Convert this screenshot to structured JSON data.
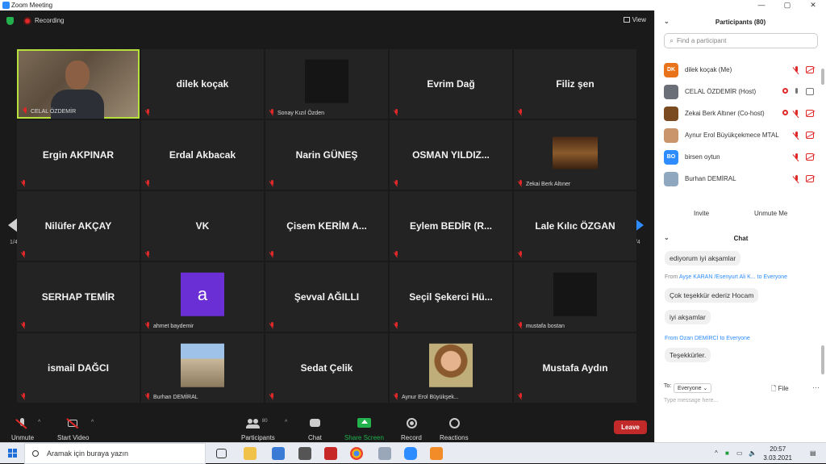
{
  "window": {
    "title": "Zoom Meeting",
    "controls": [
      "—",
      "▢",
      "✕"
    ]
  },
  "topbar": {
    "recording_label": "Recording",
    "view_label": "View"
  },
  "grid": {
    "page_indicator_left": "1/4",
    "page_indicator_right": "1/4",
    "tiles": [
      {
        "name": "",
        "label": "CELAL ÖZDEMİR",
        "kind": "video",
        "active": true
      },
      {
        "name": "dilek koçak",
        "label": "",
        "kind": "name"
      },
      {
        "name": "",
        "label": "Sonay Kızıl Özden",
        "kind": "dark"
      },
      {
        "name": "Evrim Dağ",
        "label": "",
        "kind": "name"
      },
      {
        "name": "Filiz şen",
        "label": "",
        "kind": "name"
      },
      {
        "name": "Ergin AKPINAR",
        "label": "",
        "kind": "name"
      },
      {
        "name": "Erdal Akbacak",
        "label": "",
        "kind": "name"
      },
      {
        "name": "Narin GÜNEŞ",
        "label": "",
        "kind": "name"
      },
      {
        "name": "OSMAN YILDIZ...",
        "label": "",
        "kind": "name"
      },
      {
        "name": "",
        "label": "Zekai Berk Altıner",
        "kind": "sign"
      },
      {
        "name": "Nilüfer AKÇAY",
        "label": "",
        "kind": "name"
      },
      {
        "name": "VK",
        "label": "",
        "kind": "name"
      },
      {
        "name": "Çisem KERİM A...",
        "label": "",
        "kind": "name"
      },
      {
        "name": "Eylem BEDİR (R...",
        "label": "",
        "kind": "name"
      },
      {
        "name": "Lale Kılıc ÖZGAN",
        "label": "",
        "kind": "name"
      },
      {
        "name": "SERHAP TEMİR",
        "label": "",
        "kind": "name"
      },
      {
        "name": "a",
        "label": "ahmet baydemir",
        "kind": "purple"
      },
      {
        "name": "Şevval AĞILLI",
        "label": "",
        "kind": "name"
      },
      {
        "name": "Seçil Şekerci Hü...",
        "label": "",
        "kind": "name"
      },
      {
        "name": "",
        "label": "mustafa bostan",
        "kind": "dark"
      },
      {
        "name": "ismail DAĞCI",
        "label": "",
        "kind": "name"
      },
      {
        "name": "",
        "label": "Burhan DEMİRAL",
        "kind": "building"
      },
      {
        "name": "Sedat Çelik",
        "label": "",
        "kind": "name"
      },
      {
        "name": "",
        "label": "Aynur Erol Büyükşek...",
        "kind": "woman"
      },
      {
        "name": "Mustafa Aydın",
        "label": "",
        "kind": "name"
      }
    ]
  },
  "toolbar": {
    "unmute": "Unmute",
    "start_video": "Start Video",
    "participants": "Participants",
    "participants_count": "80",
    "chat": "Chat",
    "share_screen": "Share Screen",
    "record": "Record",
    "reactions": "Reactions",
    "leave": "Leave"
  },
  "participants_panel": {
    "title": "Participants (80)",
    "search_placeholder": "Find a participant",
    "items": [
      {
        "initials": "DK",
        "name": "dilek koçak (Me)",
        "color": "#e8731a",
        "icons": [
          "micred",
          "camred"
        ]
      },
      {
        "initials": "",
        "name": "CELAL ÖZDEMİR (Host)",
        "color": "#6a6f78",
        "icons": [
          "recred",
          "micgray",
          "camgray"
        ]
      },
      {
        "initials": "",
        "name": "Zekai Berk Altıner (Co-host)",
        "color": "#7a4a20",
        "icons": [
          "recred",
          "micred",
          "camred"
        ]
      },
      {
        "initials": "",
        "name": "Aynur Erol Büyükçekmece MTAL",
        "color": "#c9946a",
        "icons": [
          "micred",
          "camred"
        ]
      },
      {
        "initials": "BO",
        "name": "birsen oytun",
        "color": "#2d8cff",
        "icons": [
          "micred",
          "camred"
        ]
      },
      {
        "initials": "",
        "name": "Burhan DEMİRAL",
        "color": "#8fa8c0",
        "icons": [
          "micred",
          "camred"
        ]
      }
    ],
    "invite_label": "Invite",
    "unmute_me_label": "Unmute Me"
  },
  "chat_panel": {
    "title": "Chat",
    "messages": [
      {
        "type": "bubble",
        "text": "ediyorum iyi akşamlar"
      },
      {
        "type": "from",
        "sender": "Ayşe KARAN /Esenyurt Ali K...",
        "to": "to Everyone"
      },
      {
        "type": "bubble",
        "text": "Çok teşekkür ederiz Hocam"
      },
      {
        "type": "bubble",
        "text": "iyi akşamlar"
      },
      {
        "type": "from",
        "sender": "From Ozan DEMİRCİ to Everyone",
        "to": ""
      },
      {
        "type": "bubble",
        "text": "Teşekkürler."
      }
    ],
    "to_label": "To:",
    "to_value": "Everyone",
    "file_label": "File",
    "more_label": "···",
    "input_placeholder": "Type message here..."
  },
  "taskbar": {
    "search_placeholder": "Aramak için buraya yazın",
    "time": "20:57",
    "date": "3.03.2021"
  },
  "colors": {
    "accent": "#2d8cff",
    "leave": "#c22a2a",
    "active_speaker": "#b6e03b",
    "mute": "#e02828"
  }
}
